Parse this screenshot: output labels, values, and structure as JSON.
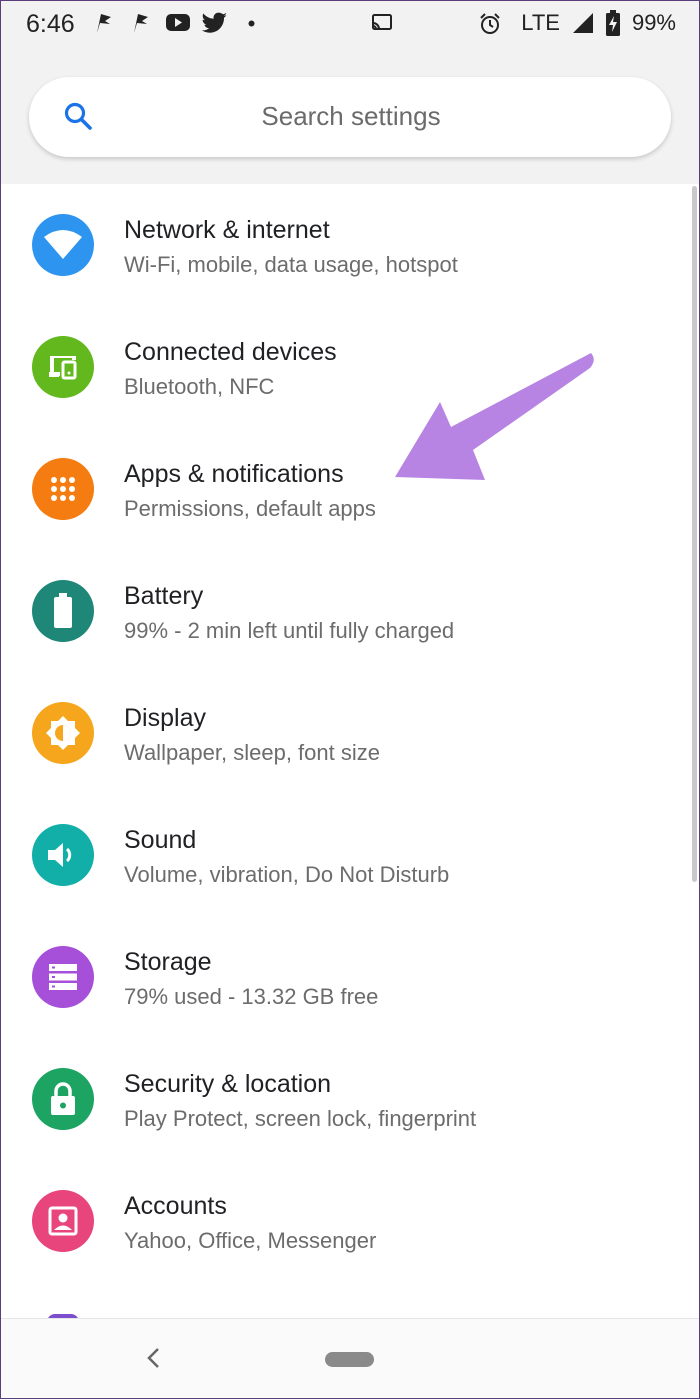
{
  "status_bar": {
    "time": "6:46",
    "network": "LTE",
    "battery": "99%",
    "icons": [
      "flag-icon",
      "flag-icon",
      "youtube-icon",
      "twitter-icon",
      "dot-icon",
      "cast-icon",
      "alarm-icon",
      "signal-icon",
      "battery-charging-icon"
    ]
  },
  "search": {
    "placeholder": "Search settings",
    "icon": "search-icon"
  },
  "colors": {
    "network": "#2d95f0",
    "devices": "#62b81d",
    "apps": "#f57c10",
    "battery": "#1f8778",
    "display": "#f6a61c",
    "sound": "#12afa9",
    "storage": "#a64fd9",
    "security": "#1da462",
    "accounts": "#e8457c",
    "annotation_arrow": "#b784e3"
  },
  "settings": [
    {
      "title": "Network & internet",
      "subtitle": "Wi-Fi, mobile, data usage, hotspot",
      "icon": "wifi-icon"
    },
    {
      "title": "Connected devices",
      "subtitle": "Bluetooth, NFC",
      "icon": "devices-icon"
    },
    {
      "title": "Apps & notifications",
      "subtitle": "Permissions, default apps",
      "icon": "apps-grid-icon"
    },
    {
      "title": "Battery",
      "subtitle": "99% - 2 min left until fully charged",
      "icon": "battery-icon"
    },
    {
      "title": "Display",
      "subtitle": "Wallpaper, sleep, font size",
      "icon": "brightness-icon"
    },
    {
      "title": "Sound",
      "subtitle": "Volume, vibration, Do Not Disturb",
      "icon": "volume-icon"
    },
    {
      "title": "Storage",
      "subtitle": "79% used - 13.32 GB free",
      "icon": "storage-icon"
    },
    {
      "title": "Security & location",
      "subtitle": "Play Protect, screen lock, fingerprint",
      "icon": "lock-icon"
    },
    {
      "title": "Accounts",
      "subtitle": "Yahoo, Office, Messenger",
      "icon": "account-box-icon"
    }
  ],
  "nav": {
    "back_icon": "back-icon",
    "home_icon": "home-pill-icon"
  }
}
